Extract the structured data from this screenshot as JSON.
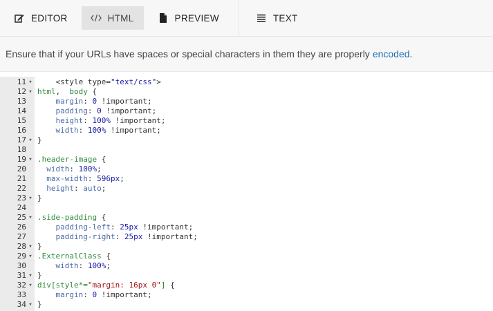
{
  "toolbar": {
    "tabs": [
      {
        "id": "editor",
        "label": "EDITOR",
        "icon": "edit-icon",
        "active": false
      },
      {
        "id": "html",
        "label": "HTML",
        "icon": "code-icon",
        "active": true
      },
      {
        "id": "preview",
        "label": "PREVIEW",
        "icon": "file-icon",
        "active": false
      },
      {
        "id": "text",
        "label": "TEXT",
        "icon": "text-align-icon",
        "active": false
      }
    ]
  },
  "notice": {
    "text": "Ensure that if your URLs have spaces or special characters in them they are properly",
    "link_text": "encoded",
    "trailing": "."
  },
  "editor": {
    "lines": [
      {
        "n": "11",
        "fold": true,
        "tokens": [
          [
            "txt",
            "    "
          ],
          [
            "tag",
            "<style "
          ],
          [
            "attr",
            "type="
          ],
          [
            "str",
            "\"text/css\""
          ],
          [
            "tag",
            ">"
          ]
        ]
      },
      {
        "n": "12",
        "fold": true,
        "tokens": [
          [
            "sel",
            "html"
          ],
          [
            "txt",
            ",  "
          ],
          [
            "sel",
            "body"
          ],
          [
            "txt",
            " {"
          ]
        ]
      },
      {
        "n": "13",
        "fold": false,
        "tokens": [
          [
            "txt",
            "    "
          ],
          [
            "prop",
            "margin"
          ],
          [
            "txt",
            ": "
          ],
          [
            "num",
            "0"
          ],
          [
            "txt",
            " !important;"
          ]
        ]
      },
      {
        "n": "14",
        "fold": false,
        "tokens": [
          [
            "txt",
            "    "
          ],
          [
            "prop",
            "padding"
          ],
          [
            "txt",
            ": "
          ],
          [
            "num",
            "0"
          ],
          [
            "txt",
            " !important;"
          ]
        ]
      },
      {
        "n": "15",
        "fold": false,
        "tokens": [
          [
            "txt",
            "    "
          ],
          [
            "prop",
            "height"
          ],
          [
            "txt",
            ": "
          ],
          [
            "num",
            "100%"
          ],
          [
            "txt",
            " !important;"
          ]
        ]
      },
      {
        "n": "16",
        "fold": false,
        "tokens": [
          [
            "txt",
            "    "
          ],
          [
            "prop",
            "width"
          ],
          [
            "txt",
            ": "
          ],
          [
            "num",
            "100%"
          ],
          [
            "txt",
            " !important;"
          ]
        ]
      },
      {
        "n": "17",
        "fold": true,
        "tokens": [
          [
            "txt",
            "}"
          ]
        ]
      },
      {
        "n": "18",
        "fold": false,
        "tokens": [
          [
            "txt",
            ""
          ]
        ]
      },
      {
        "n": "19",
        "fold": true,
        "tokens": [
          [
            "sel",
            ".header-image"
          ],
          [
            "txt",
            " {"
          ]
        ]
      },
      {
        "n": "20",
        "fold": false,
        "tokens": [
          [
            "txt",
            "  "
          ],
          [
            "prop",
            "width"
          ],
          [
            "txt",
            ": "
          ],
          [
            "num",
            "100%"
          ],
          [
            "txt",
            ";"
          ]
        ]
      },
      {
        "n": "21",
        "fold": false,
        "tokens": [
          [
            "txt",
            "  "
          ],
          [
            "prop",
            "max-width"
          ],
          [
            "txt",
            ": "
          ],
          [
            "num",
            "596px"
          ],
          [
            "txt",
            ";"
          ]
        ]
      },
      {
        "n": "22",
        "fold": false,
        "tokens": [
          [
            "txt",
            "  "
          ],
          [
            "prop",
            "height"
          ],
          [
            "txt",
            ": "
          ],
          [
            "prop",
            "auto"
          ],
          [
            "txt",
            ";"
          ]
        ]
      },
      {
        "n": "23",
        "fold": true,
        "tokens": [
          [
            "txt",
            "}"
          ]
        ]
      },
      {
        "n": "24",
        "fold": false,
        "tokens": [
          [
            "txt",
            ""
          ]
        ]
      },
      {
        "n": "25",
        "fold": true,
        "tokens": [
          [
            "sel",
            ".side-padding"
          ],
          [
            "txt",
            " {"
          ]
        ]
      },
      {
        "n": "26",
        "fold": false,
        "tokens": [
          [
            "txt",
            "    "
          ],
          [
            "prop",
            "padding-left"
          ],
          [
            "txt",
            ": "
          ],
          [
            "num",
            "25px"
          ],
          [
            "txt",
            " !important;"
          ]
        ]
      },
      {
        "n": "27",
        "fold": false,
        "tokens": [
          [
            "txt",
            "    "
          ],
          [
            "prop",
            "padding-right"
          ],
          [
            "txt",
            ": "
          ],
          [
            "num",
            "25px"
          ],
          [
            "txt",
            " !important;"
          ]
        ]
      },
      {
        "n": "28",
        "fold": true,
        "tokens": [
          [
            "txt",
            "}"
          ]
        ]
      },
      {
        "n": "29",
        "fold": true,
        "tokens": [
          [
            "sel",
            ".ExternalClass"
          ],
          [
            "txt",
            " {"
          ]
        ]
      },
      {
        "n": "30",
        "fold": false,
        "tokens": [
          [
            "txt",
            "    "
          ],
          [
            "prop",
            "width"
          ],
          [
            "txt",
            ": "
          ],
          [
            "num",
            "100%"
          ],
          [
            "txt",
            ";"
          ]
        ]
      },
      {
        "n": "31",
        "fold": true,
        "tokens": [
          [
            "txt",
            "}"
          ]
        ]
      },
      {
        "n": "32",
        "fold": true,
        "tokens": [
          [
            "sel",
            "div[style*="
          ],
          [
            "str2",
            "\"margin: 16px 0\""
          ],
          [
            "sel",
            "]"
          ],
          [
            "txt",
            " {"
          ]
        ]
      },
      {
        "n": "33",
        "fold": false,
        "tokens": [
          [
            "txt",
            "    "
          ],
          [
            "prop",
            "margin"
          ],
          [
            "txt",
            ": "
          ],
          [
            "num",
            "0"
          ],
          [
            "txt",
            " !important;"
          ]
        ]
      },
      {
        "n": "34",
        "fold": true,
        "tokens": [
          [
            "txt",
            "}"
          ]
        ]
      }
    ]
  },
  "colors": {
    "toolbar_bg": "#f7f7f7",
    "active_tab_bg": "#e3e3e3",
    "link": "#1f6fb5",
    "gutter_bg": "#ebebeb",
    "selector": "#2d8a3c",
    "property": "#4b6ba8",
    "number": "#1a1aa6",
    "string_attr": "#a31515"
  }
}
